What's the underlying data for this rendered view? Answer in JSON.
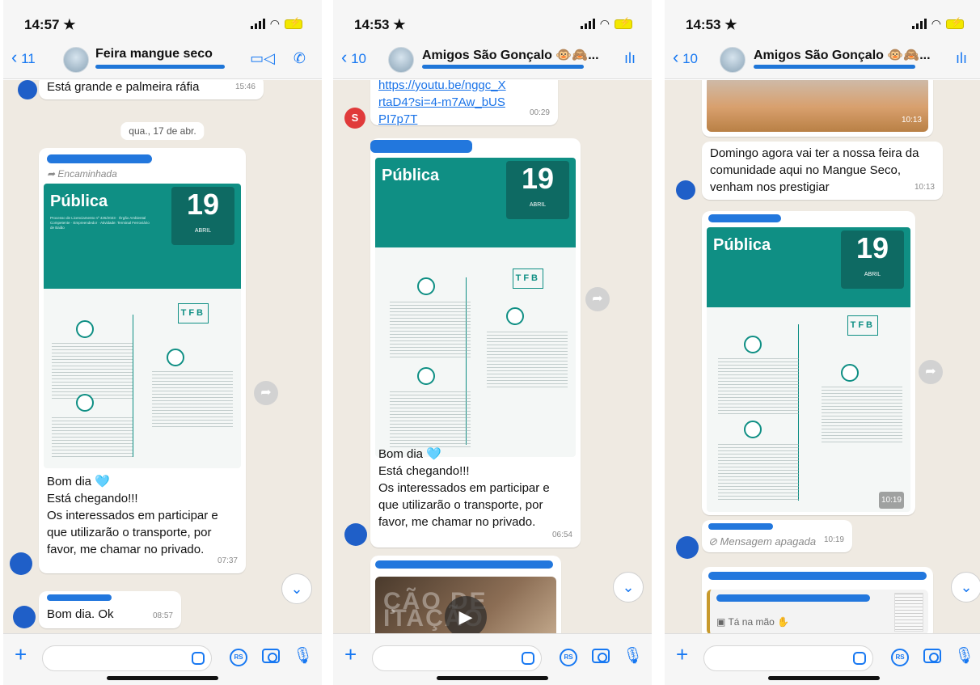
{
  "phones": [
    {
      "status_time": "14:57 ★",
      "back_count": "11",
      "chat_title": "Feira mangue seco",
      "msg_top_text": "Está grande e palmeira ráfia",
      "msg_top_time": "15:46",
      "date_divider": "qua., 17 de abr.",
      "forwarded_label": "Encaminhada",
      "poster_title": "Pública",
      "poster_day": "19",
      "poster_month": "ABRIL",
      "poster_tfb": "TFB",
      "poster_text": "Processo de Licenciamento nº 426/2023 · Órgão Ambiental Competente · Empreendedor · Atividade: Terminal Ferroviário de Baião",
      "caption_line1": "Bom dia 🩵",
      "caption_line2": "Está chegando!!!",
      "caption_line3": "Os interessados em participar e que utilizarão o transporte, por favor, me chamar no privado.",
      "caption_time": "07:37",
      "reply_text": "Bom dia. Ok",
      "reply_time": "08:57"
    },
    {
      "status_time": "14:53 ★",
      "back_count": "10",
      "chat_title": "Amigos São Gonçalo 🐵🙈...",
      "link_text": "https://youtu.be/nggc_XrtaD4?si=4-m7Aw_bUSPI7p7T",
      "link_time": "00:29",
      "sender_initial": "S",
      "poster_title": "Pública",
      "poster_day": "19",
      "poster_month": "ABRIL",
      "poster_tfb": "TFB",
      "caption_line1": "Bom dia 🩵",
      "caption_line2": "Está chegando!!!",
      "caption_line3": "Os interessados em participar e que utilizarão o transporte, por favor, me chamar no privado.",
      "caption_time": "06:54",
      "video_text": "ÇÃO DE ITAÇÃO"
    },
    {
      "status_time": "14:53 ★",
      "back_count": "10",
      "chat_title": "Amigos São Gonçalo 🐵🙈...",
      "image_time": "10:13",
      "msg_text": "Domingo agora vai ter a nossa feira da comunidade aqui no Mangue Seco, venham nos prestigiar",
      "msg_time": "10:13",
      "poster_title": "Pública",
      "poster_day": "19",
      "poster_month": "ABRIL",
      "poster_tfb": "TFB",
      "poster_time": "10:19",
      "deleted_text": "Mensagem apagada",
      "deleted_time": "10:19",
      "quote_text": "Tá na mão ✋"
    }
  ],
  "input_bar": {
    "rs_label": "RS"
  },
  "colors": {
    "accent": "#1778f2",
    "chat_bg": "#efeae2",
    "poster_teal": "#0f8f84",
    "redaction": "#2277dd"
  }
}
